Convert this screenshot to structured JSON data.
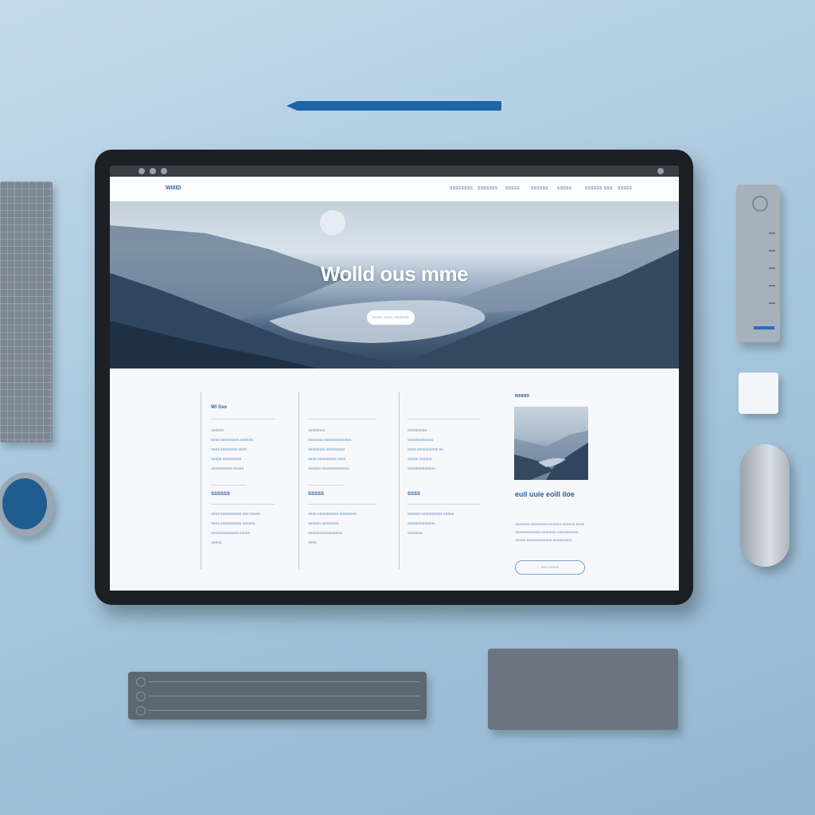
{
  "site": {
    "logo": "WIIIID",
    "nav": [
      "SSSSSSSS",
      "SSSSSSS",
      "SSSSS",
      "SSSSSS",
      "SSSSS",
      "SSSSSS SSS",
      "SSSSS"
    ]
  },
  "hero": {
    "title": "Wolld ous mme",
    "button_label": "SSSS SSSS SSSSSS"
  },
  "columns": [
    {
      "sections": [
        {
          "heading": "Wi Sso",
          "links": [
            "SSSSSS",
            "SSSS SSSSSSSSS SSSSSS",
            "SSSS SSSSSSSS SSSS",
            "SSSSS SSSSSSSSS",
            "SSSSSSSSSS SSSSS"
          ]
        },
        {
          "heading": "SSSSSS",
          "links": [
            "SSSS SSSSSSSSSS SSS SSSSS",
            "SSSS SSSSSSSSSS SSSSSS",
            "SSSSSSSSSSSSS SSSSS",
            "SSSSS"
          ]
        }
      ]
    },
    {
      "sections": [
        {
          "heading": "",
          "links": [
            "SSSSSSSS",
            "SSSSSSS SSSSSSSSSSSSS",
            "SSSSSSSS SSSSSSSSS",
            "SSSS SSSSSSSSS SSSS",
            "SSSSSS SSSSSSSSSSSSS"
          ]
        },
        {
          "heading": "SSSSS",
          "links": [
            "SSSS SSSSSSSSSS SSSSSSSS",
            "SSSSSS SSSSSSSS",
            "SSSSSSSSSSSSSSSS",
            "SSSS"
          ]
        }
      ]
    },
    {
      "sections": [
        {
          "heading": "",
          "links": [
            "SSSSSSSSS",
            "SSSSSSSSSSSS",
            "SSSS SSSSSSSSSS SS",
            "SSSSS SSSSSS",
            "SSSSSSSSSSSSS"
          ]
        },
        {
          "heading": "SSSS",
          "links": [
            "SSSSSS SSSSSSSSSS SSSSS",
            "SSSSSSSSSSSSS",
            "SSSSSSS"
          ]
        }
      ]
    }
  ],
  "card": {
    "label": "WIIIIIIID",
    "title": "euil uuie eoill iloe",
    "paragraph": [
      "SSSSSSS SSSSSSSS SSSSSS SSSSSS SSSS",
      "SSSSSSSSSSSS SSSSSSS SSSSSSSSSS",
      "SSSSS SSSSSSSSSSSS SSSSSSSSS"
    ],
    "button_label": "SSS SSSSS"
  },
  "colors": {
    "accent": "#3466a3",
    "tablet_bezel": "#1c1f24",
    "background": "#a9c8de",
    "pencil": "#1d64a8",
    "cup": "#1f5c8f"
  }
}
